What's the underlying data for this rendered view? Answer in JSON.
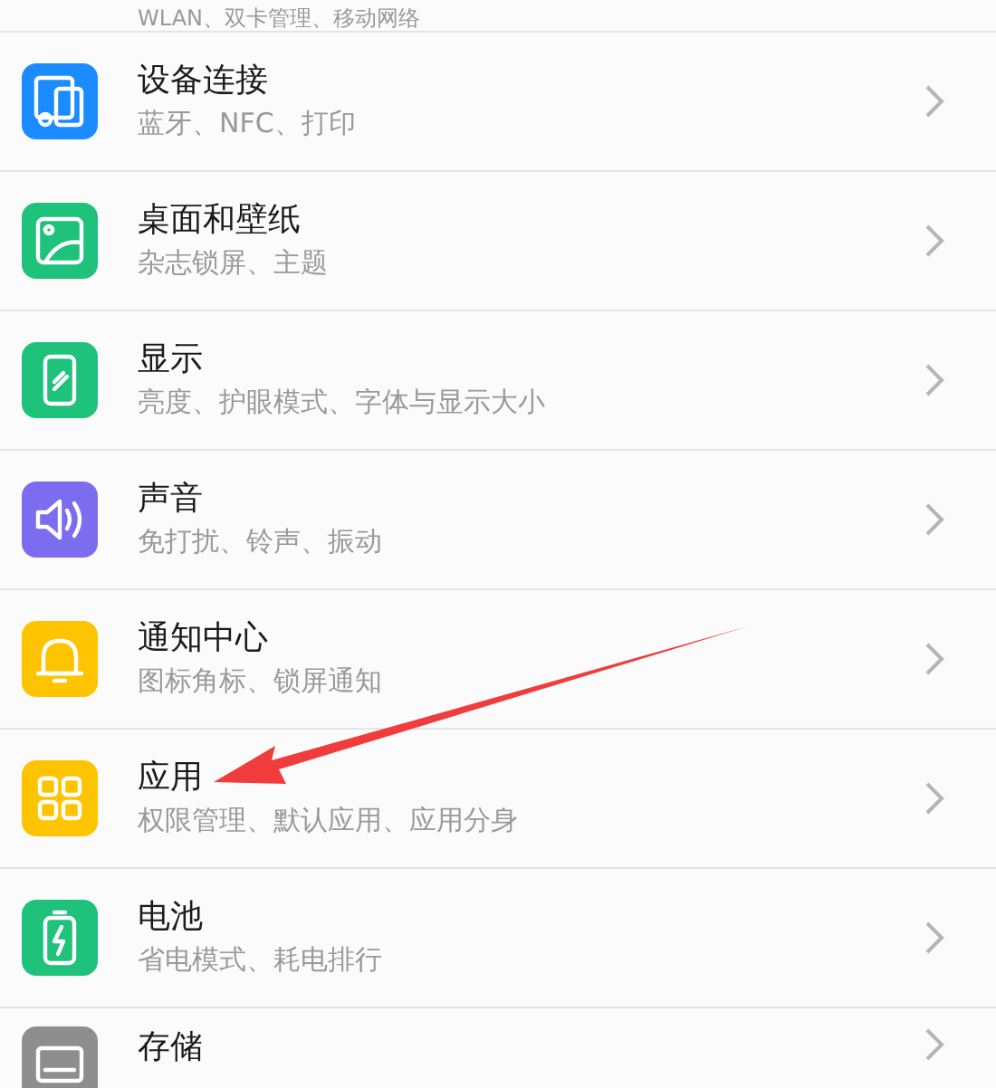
{
  "top_item": {
    "subtitle": "WLAN、双卡管理、移动网络"
  },
  "items": [
    {
      "kind": "devices",
      "color": "#1a8cff",
      "title": "设备连接",
      "subtitle": "蓝牙、NFC、打印"
    },
    {
      "kind": "wallpaper",
      "color": "#1ec27a",
      "title": "桌面和壁纸",
      "subtitle": "杂志锁屏、主题"
    },
    {
      "kind": "display",
      "color": "#1ec27a",
      "title": "显示",
      "subtitle": "亮度、护眼模式、字体与显示大小"
    },
    {
      "kind": "sound",
      "color": "#7b6cf0",
      "title": "声音",
      "subtitle": "免打扰、铃声、振动"
    },
    {
      "kind": "bell",
      "color": "#ffc400",
      "title": "通知中心",
      "subtitle": "图标角标、锁屏通知"
    },
    {
      "kind": "apps",
      "color": "#ffc400",
      "title": "应用",
      "subtitle": "权限管理、默认应用、应用分身"
    },
    {
      "kind": "battery",
      "color": "#1ec27a",
      "title": "电池",
      "subtitle": "省电模式、耗电排行"
    },
    {
      "kind": "storage",
      "color": "#8e8e8e",
      "title": "存储"
    }
  ]
}
